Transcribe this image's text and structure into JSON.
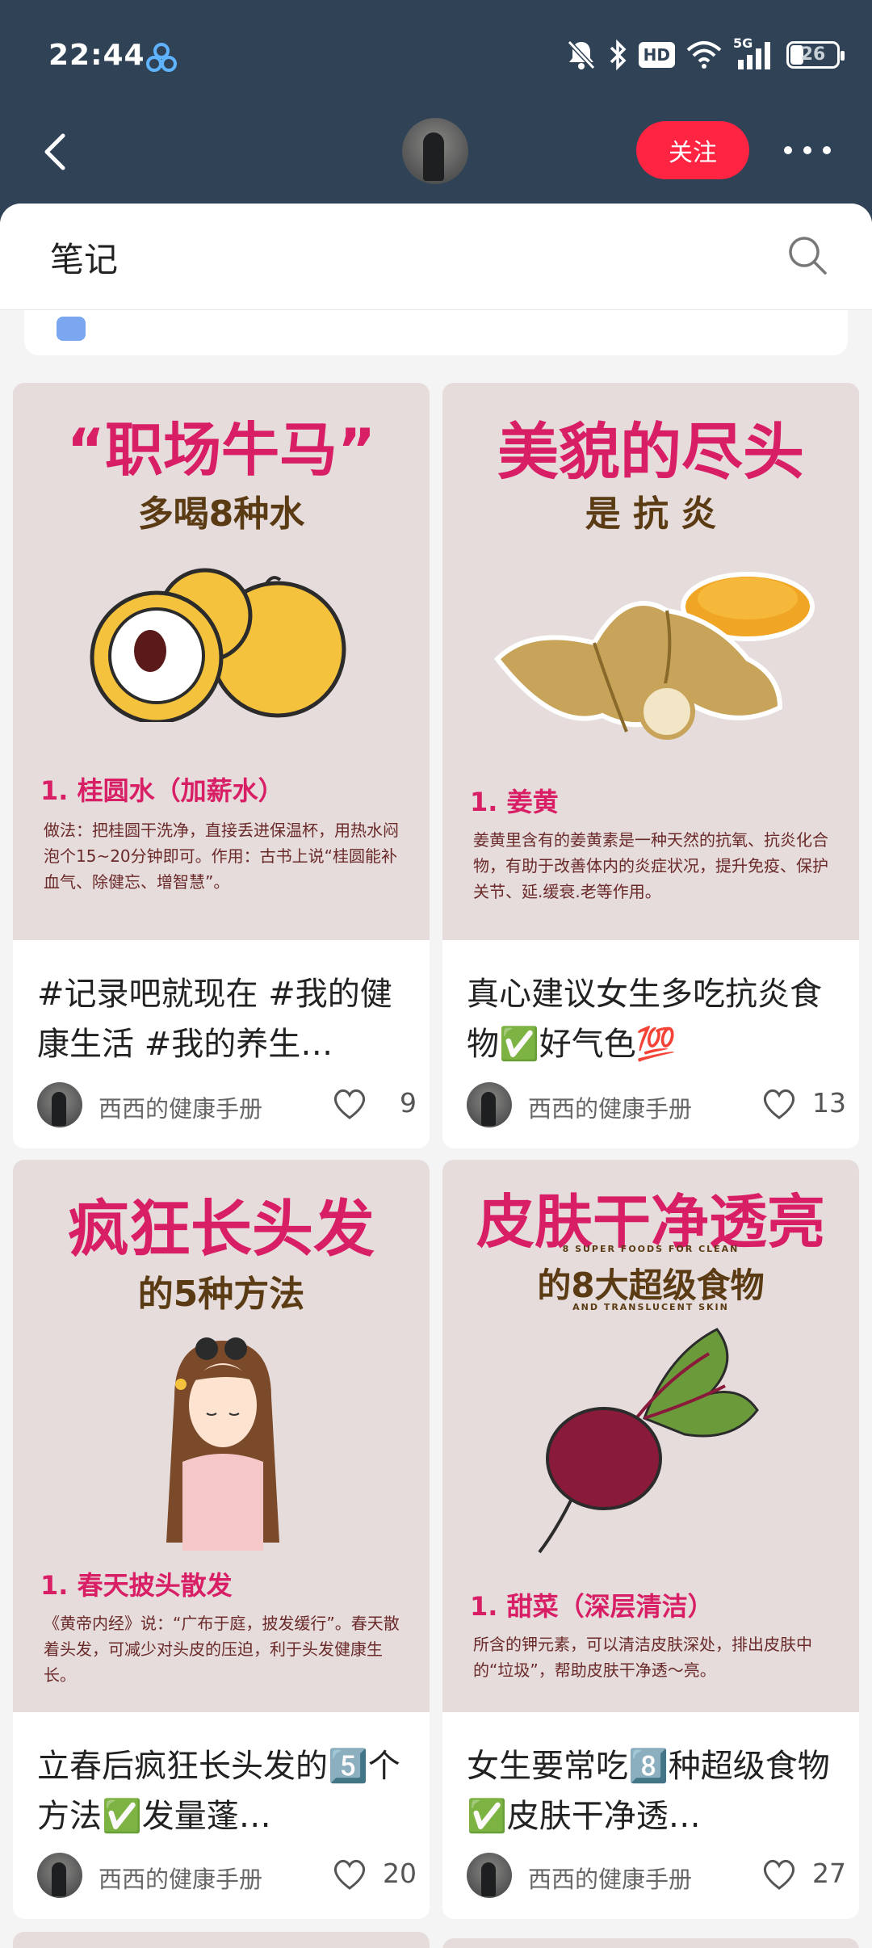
{
  "status_bar": {
    "time": "22:44",
    "network": "5G",
    "hd_label": "HD",
    "battery": "26"
  },
  "header": {
    "follow_label": "关注"
  },
  "panel": {
    "title": "笔记"
  },
  "colors": {
    "accent": "#ff2442",
    "header_bg": "#2f4256",
    "cover_pink": "#d81f66"
  },
  "notes": [
    {
      "title": "#记录吧就现在 #我的健康生活 #我的养生…",
      "author": "西西的健康手册",
      "likes": "9",
      "cover": {
        "headline": "“职场牛马”",
        "subheadline": "多喝8种水",
        "item_heading": "1. 桂圆水（加薪水）",
        "item_body": "做法：把桂圆干洗净，直接丢进保温杯，用热水闷泡个15~20分钟即可。作用：古书上说“桂圆能补血气、除健忘、增智慧”。",
        "art": "longan-icon"
      }
    },
    {
      "title": "真心建议女生多吃抗炎食物✅好气色💯",
      "author": "西西的健康手册",
      "likes": "13",
      "cover": {
        "headline": "美貌的尽头",
        "subheadline": "是 抗 炎",
        "item_heading": "1. 姜黄",
        "item_body": "姜黄里含有的姜黄素是一种天然的抗氧、抗炎化合物，有助于改善体内的炎症状况，提升免疫、保护关节、延.缓衰.老等作用。",
        "art": "turmeric-icon"
      }
    },
    {
      "title": "立春后疯狂长头发的5️⃣个方法✅发量蓬…",
      "author": "西西的健康手册",
      "likes": "20",
      "cover": {
        "headline": "疯狂长头发",
        "subheadline": "的5种方法",
        "item_heading": "1. 春天披头散发",
        "item_body": "《黄帝内经》说：“广布于庭，披发缓行”。春天散着头发，可减少对头皮的压迫，利于头发健康生长。",
        "art": "girl-icon"
      }
    },
    {
      "title": "女生要常吃8️⃣种超级食物✅皮肤干净透…",
      "author": "西西的健康手册",
      "likes": "27",
      "cover": {
        "headline": "皮肤干净透亮",
        "subheadline": "的8大超级食物",
        "tagline_top": "8 SUPER FOODS FOR CLEAN",
        "tagline_bottom": "AND TRANSLUCENT SKIN",
        "item_heading": "1. 甜菜（深层清洁）",
        "item_body": "所含的钾元素，可以清洁皮肤深处，排出皮肤中的“垃圾”，帮助皮肤干净透～亮。",
        "art": "beet-icon"
      }
    }
  ]
}
